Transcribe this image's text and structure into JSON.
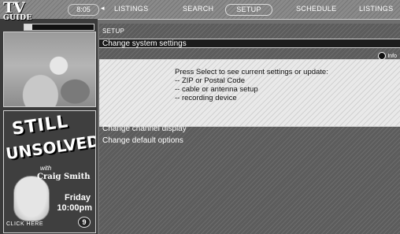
{
  "app": {
    "logo_tv": "TV",
    "logo_guide": "GUIDE"
  },
  "nav": {
    "time": "8:05",
    "arrow_left": "◂",
    "tabs": [
      {
        "label": "LISTINGS",
        "selected": false
      },
      {
        "label": "SEARCH",
        "selected": false
      },
      {
        "label": "SETUP",
        "selected": true
      },
      {
        "label": "SCHEDULE",
        "selected": false
      },
      {
        "label": "LISTINGS",
        "selected": false
      }
    ]
  },
  "promo": {
    "title_1": "STILL",
    "title_2": "UNSOLVED",
    "with": "with",
    "host": "Craig Smith",
    "day": "Friday",
    "time": "10:00pm",
    "channel": "9",
    "click_here": "CLICK HERE"
  },
  "main": {
    "breadcrumb": "SETUP",
    "sections": [
      {
        "label": "Change system settings",
        "expanded": true
      },
      {
        "label": "Change channel display",
        "expanded": false
      },
      {
        "label": "Change default options",
        "expanded": false
      }
    ],
    "info_label": "Info",
    "info_lines": [
      "Press Select to see current settings or update:",
      "-- ZIP or Postal Code",
      "-- cable or antenna setup",
      "-- recording device"
    ]
  }
}
